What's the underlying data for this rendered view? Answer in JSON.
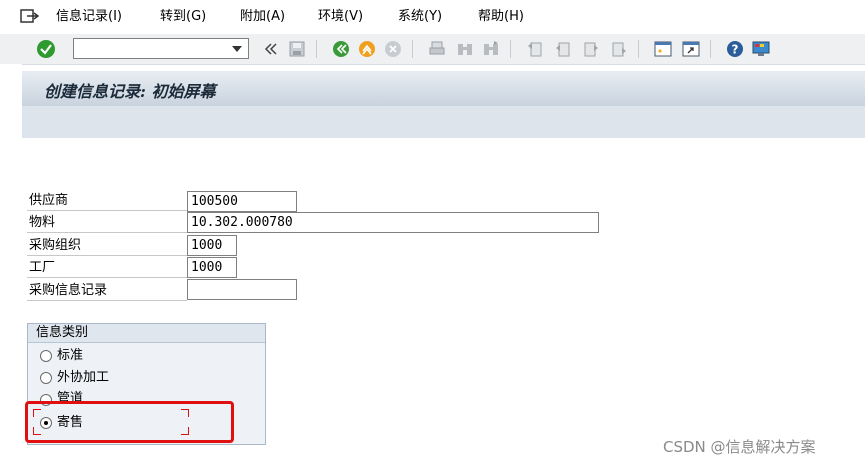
{
  "menu": {
    "items": [
      "信息记录(I)",
      "转到(G)",
      "附加(A)",
      "环境(V)",
      "系统(Y)",
      "帮助(H)"
    ]
  },
  "toolbar": {
    "command_field_value": "",
    "icons": [
      "enter-icon",
      "command-dropdown-icon",
      "save-icon",
      "back-icon",
      "exit-icon",
      "cancel-icon",
      "print-icon",
      "find-icon",
      "find-next-icon",
      "first-page-icon",
      "prev-page-icon",
      "next-page-icon",
      "last-page-icon",
      "new-session-icon",
      "shortcut-icon",
      "help-icon",
      "layout-icon"
    ]
  },
  "page": {
    "title": "创建信息记录: 初始屏幕"
  },
  "form": {
    "fields": [
      {
        "label": "供应商",
        "value": "100500"
      },
      {
        "label": "物料",
        "value": "10.302.000780"
      },
      {
        "label": "采购组织",
        "value": "1000"
      },
      {
        "label": "工厂",
        "value": "1000"
      },
      {
        "label": "采购信息记录",
        "value": ""
      }
    ]
  },
  "info_category": {
    "title": "信息类别",
    "options": [
      {
        "label": "标准",
        "selected": false
      },
      {
        "label": "外协加工",
        "selected": false
      },
      {
        "label": "管道",
        "selected": false
      },
      {
        "label": "寄售",
        "selected": true
      }
    ]
  },
  "watermark": "CSDN @信息解决方案",
  "colors": {
    "highlight": "#e01010",
    "title_bar": "#dde4ec",
    "ok_green": "#2f9a2f"
  }
}
